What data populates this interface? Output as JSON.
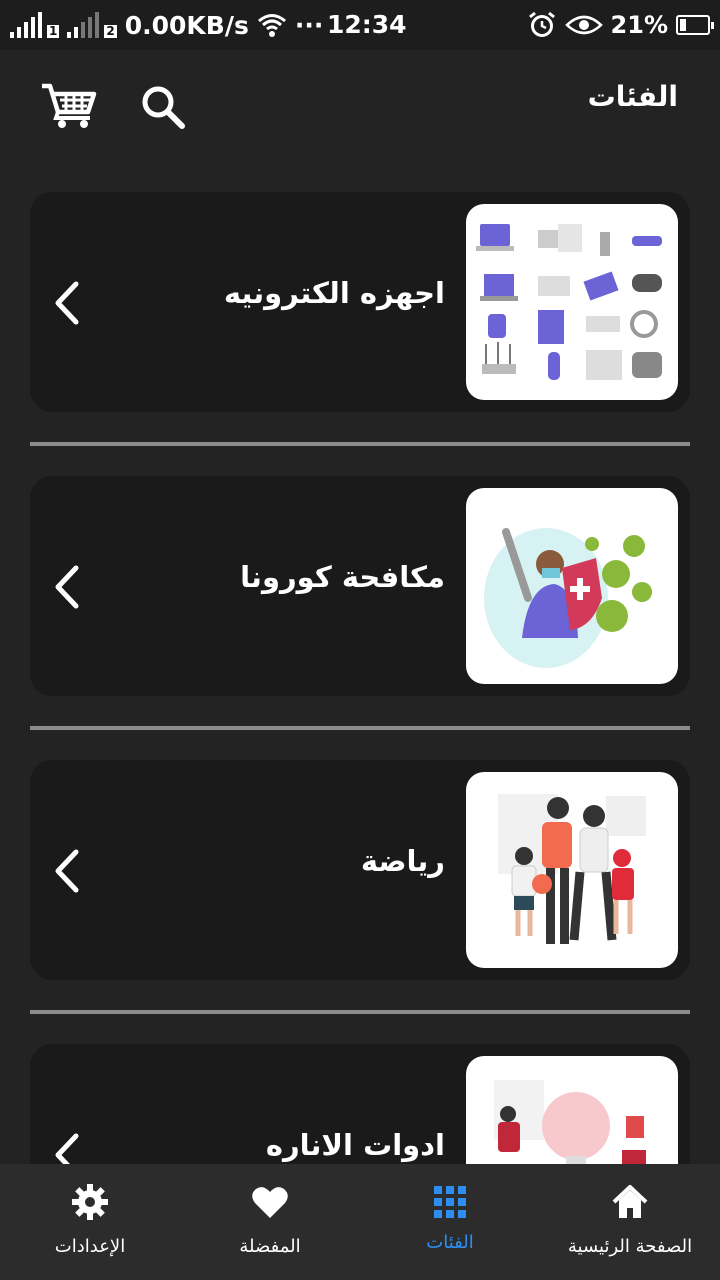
{
  "status_bar": {
    "sim1": "1",
    "sim2": "2",
    "net_speed": "0.00KB/s",
    "dots": "···",
    "time": "12:34",
    "battery": "21%",
    "battery_level": 0.21
  },
  "app_bar": {
    "title": "الفئات",
    "cart_icon": "cart-icon",
    "search_icon": "search-icon"
  },
  "categories": [
    {
      "label": "اجهزه الكترونيه",
      "image": "electronics-illustration"
    },
    {
      "label": "مكافحة كورونا",
      "image": "corona-fight-illustration"
    },
    {
      "label": "رياضة",
      "image": "sports-family-illustration"
    },
    {
      "label": "ادوات الاناره",
      "image": "lighting-illustration"
    }
  ],
  "bottom_nav": {
    "active_color": "#2d8ff2",
    "items": [
      {
        "label": "الصفحة الرئيسية",
        "icon": "home-icon",
        "active": false
      },
      {
        "label": "الفئات",
        "icon": "grid-icon",
        "active": true
      },
      {
        "label": "المفضلة",
        "icon": "heart-icon",
        "active": false
      },
      {
        "label": "الإعدادات",
        "icon": "gear-icon",
        "active": false
      }
    ]
  }
}
